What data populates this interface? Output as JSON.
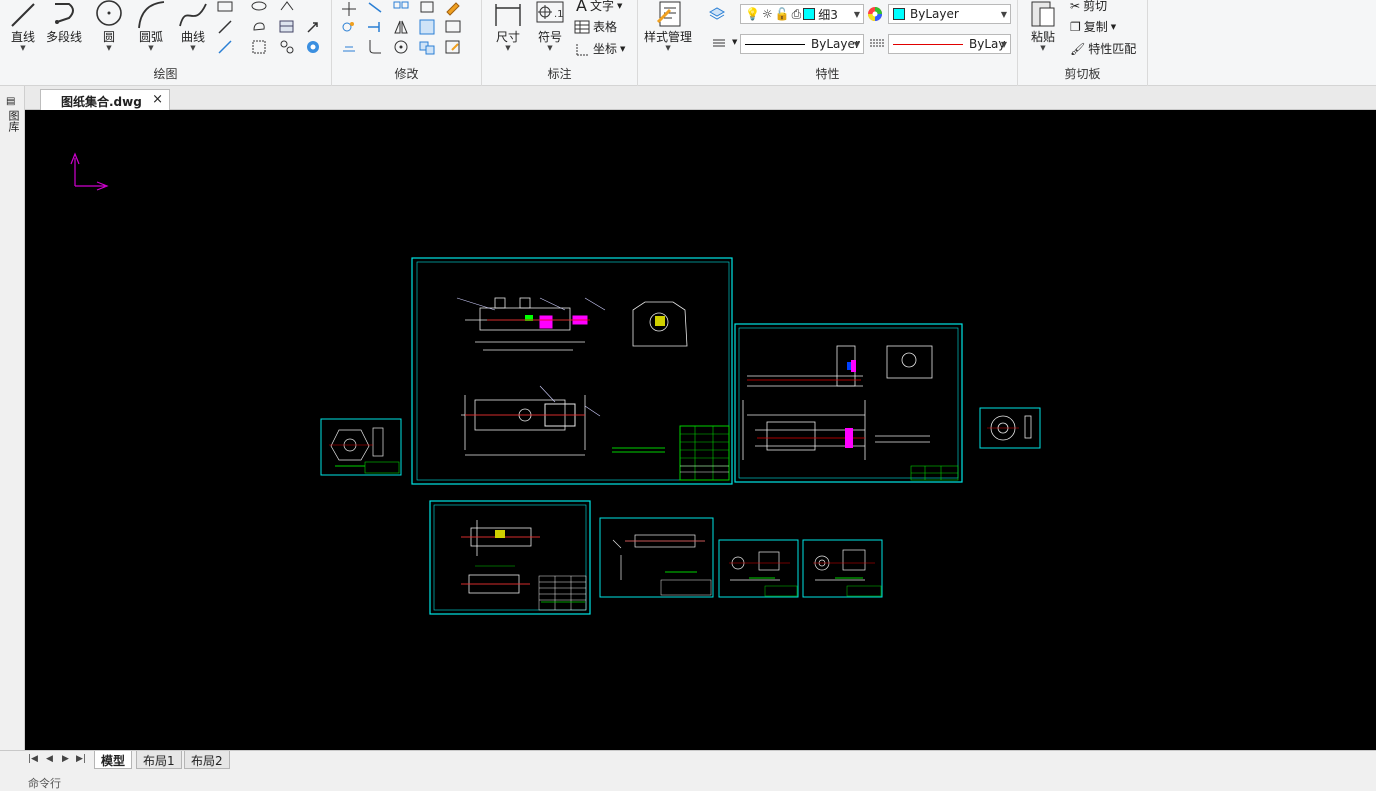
{
  "ribbon": {
    "draw": {
      "title": "绘图",
      "line": "直线",
      "polyline": "多段线",
      "circle": "圆",
      "arc": "圆弧",
      "curve": "曲线"
    },
    "modify": {
      "title": "修改"
    },
    "annotate": {
      "title": "标注",
      "dimension": "尺寸",
      "symbol": "符号",
      "text": "文字",
      "table": "表格",
      "coordinate": "坐标"
    },
    "properties": {
      "title": "特性",
      "style_manager": "样式管理",
      "layer_value": "细3",
      "color_value": "ByLayer",
      "linetype_value": "ByLayer",
      "lineweight_value": "ByLay"
    },
    "clipboard": {
      "title": "剪切板",
      "paste": "粘贴",
      "cut": "剪切",
      "copy": "复制",
      "match": "特性匹配"
    }
  },
  "document": {
    "tab_title": "图纸集合.dwg",
    "close_glyph": "×"
  },
  "left_panel": {
    "label": "图库"
  },
  "layout_tabs": [
    "模型",
    "布局1",
    "布局2"
  ],
  "command_line": {
    "label": "命令行"
  },
  "colors": {
    "canvas": "#000000",
    "frame": "#00e5e5",
    "ucs": "#d000d0",
    "accent_green": "#00d000",
    "accent_red": "#e00000",
    "accent_magenta": "#ff00ff"
  }
}
